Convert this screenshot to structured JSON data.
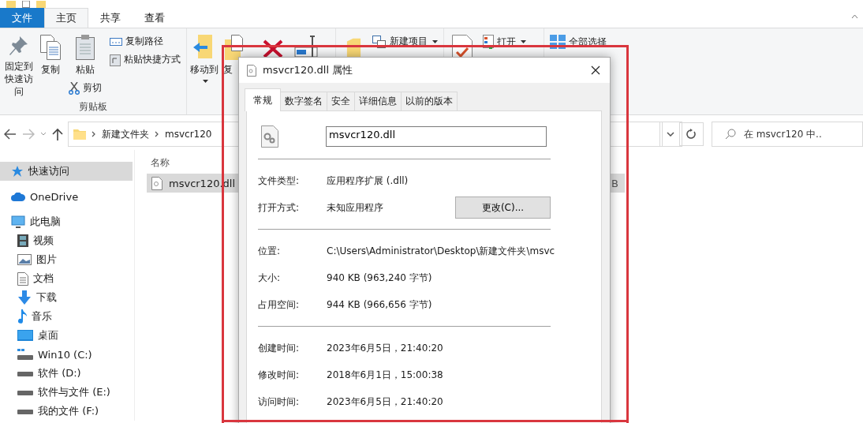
{
  "ribbon": {
    "tabs": [
      {
        "label": "文件",
        "kind": "file",
        "selected": false
      },
      {
        "label": "主页",
        "kind": "tab",
        "selected": true
      },
      {
        "label": "共享",
        "kind": "tab",
        "selected": false
      },
      {
        "label": "查看",
        "kind": "tab",
        "selected": false
      }
    ],
    "clipboard": {
      "pin": "固定到快速访问",
      "copy": "复制",
      "paste": "粘贴",
      "cut": "剪切",
      "copy_path": "复制路径",
      "paste_shortcut": "粘贴快捷方式",
      "group_label": "剪贴板"
    },
    "organize": {
      "move_to": "移动到",
      "copy_to": "复"
    },
    "new": {
      "new_item": "新建项目"
    },
    "open": {
      "open": "打开"
    },
    "select": {
      "select_all": "全部选择"
    }
  },
  "address_bar": {
    "path": [
      "新建文件夹",
      "msvcr120"
    ]
  },
  "search": {
    "placeholder": "在 msvcr120 中.."
  },
  "sidebar": {
    "items": [
      {
        "label": "快速访问",
        "selected": true
      },
      {
        "label": "OneDrive",
        "selected": false
      },
      {
        "label": "此电脑",
        "selected": false,
        "children": [
          {
            "label": "视频",
            "selected": false
          },
          {
            "label": "图片",
            "selected": false
          },
          {
            "label": "文档",
            "selected": false
          },
          {
            "label": "下载",
            "selected": false
          },
          {
            "label": "音乐",
            "selected": false
          },
          {
            "label": "桌面",
            "selected": false
          },
          {
            "label": "Win10 (C:)",
            "selected": false
          },
          {
            "label": "软件 (D:)",
            "selected": false
          },
          {
            "label": "软件与文件 (E:)",
            "selected": false
          },
          {
            "label": "我的文件 (F:)",
            "selected": false
          }
        ]
      }
    ]
  },
  "file_list": {
    "columns": [
      "名称"
    ],
    "rows": [
      {
        "name": "msvcr120.dll",
        "column_2": "B",
        "selected": true
      }
    ]
  },
  "dialog": {
    "title": "msvcr120.dll 属性",
    "tabs": [
      {
        "label": "常规",
        "selected": true
      },
      {
        "label": "数字签名",
        "selected": false
      },
      {
        "label": "安全",
        "selected": false
      },
      {
        "label": "详细信息",
        "selected": false
      },
      {
        "label": "以前的版本",
        "selected": false
      }
    ],
    "file_name": "msvcr120.dll",
    "sections": [
      [
        {
          "label": "文件类型:",
          "value": "应用程序扩展 (.dll)"
        },
        {
          "label": "打开方式:",
          "value": "未知应用程序",
          "button": "更改(C)..."
        }
      ],
      [
        {
          "label": "位置:",
          "value": "C:\\Users\\Administrator\\Desktop\\新建文件夹\\msvc"
        },
        {
          "label": "大小:",
          "value": "940 KB (963,240 字节)"
        },
        {
          "label": "占用空间:",
          "value": "944 KB (966,656 字节)"
        }
      ],
      [
        {
          "label": "创建时间:",
          "value": "2023年6月5日，21:40:20"
        },
        {
          "label": "修改时间:",
          "value": "2018年6月1日，15:00:38"
        },
        {
          "label": "访问时间:",
          "value": "2023年6月5日，21:40:20"
        }
      ]
    ]
  }
}
